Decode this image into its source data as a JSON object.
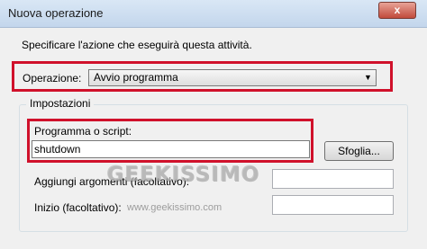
{
  "window": {
    "title": "Nuova operazione",
    "close_label": "x"
  },
  "instruction": "Specificare l'azione che eseguirà questa attività.",
  "operation": {
    "label": "Operazione:",
    "selected": "Avvio programma",
    "arrow": "▼"
  },
  "settings": {
    "group_label": "Impostazioni",
    "program_label": "Programma o script:",
    "program_value": "shutdown",
    "browse_label": "Sfoglia...",
    "args_label": "Aggiungi argomenti (facoltativo):",
    "args_value": "",
    "start_label": "Inizio (facoltativo):",
    "start_value": ""
  },
  "watermark": {
    "logo": "GEEKISSIMO",
    "url": "www.geekissimo.com"
  },
  "colors": {
    "highlight": "#d0112b",
    "titlebar": "#c3d6ec",
    "close_button": "#c14b3c"
  }
}
